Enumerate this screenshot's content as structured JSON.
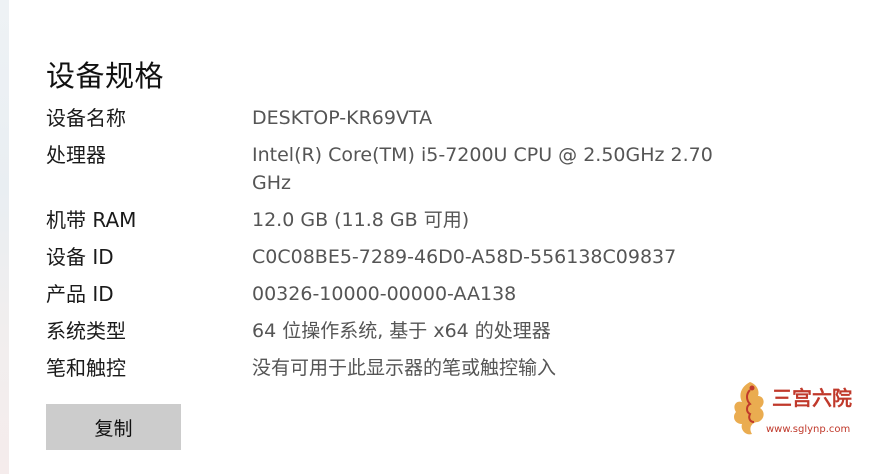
{
  "page": {
    "title": "设备规格"
  },
  "specs": [
    {
      "label": "设备名称",
      "value": "DESKTOP-KR69VTA"
    },
    {
      "label": "处理器",
      "value": "Intel(R) Core(TM) i5-7200U CPU @ 2.50GHz   2.70 GHz"
    },
    {
      "label": "机带 RAM",
      "value": "12.0 GB (11.8 GB 可用)"
    },
    {
      "label": "设备 ID",
      "value": "C0C08BE5-7289-46D0-A58D-556138C09837"
    },
    {
      "label": "产品 ID",
      "value": "00326-10000-00000-AA138"
    },
    {
      "label": "系统类型",
      "value": "64 位操作系统, 基于 x64 的处理器"
    },
    {
      "label": "笔和触控",
      "value": "没有可用于此显示器的笔或触控输入"
    }
  ],
  "actions": {
    "copy_label": "复制"
  },
  "watermark": {
    "name": "三宫六院",
    "url": "www.sglynp.com"
  },
  "colors": {
    "label": "#1a1a1a",
    "value": "#555555",
    "button_bg": "#cccccc",
    "watermark": "#c0392b"
  }
}
